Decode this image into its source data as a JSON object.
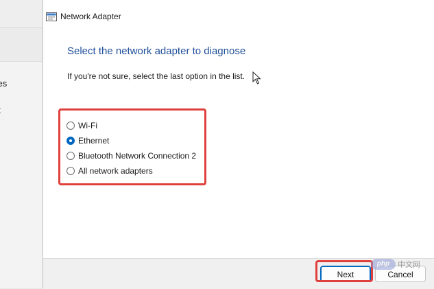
{
  "background_window": {
    "fragments": [
      "ces",
      "et"
    ]
  },
  "dialog": {
    "title": "Network Adapter",
    "heading": "Select the network adapter to diagnose",
    "subtext": "If you're not sure, select the last option in the list.",
    "options": [
      {
        "label": "Wi-Fi",
        "checked": false
      },
      {
        "label": "Ethernet",
        "checked": true
      },
      {
        "label": "Bluetooth Network Connection 2",
        "checked": false
      },
      {
        "label": "All network adapters",
        "checked": false
      }
    ],
    "buttons": {
      "next_label": "Next",
      "cancel_label": "Cancel"
    }
  },
  "watermark": {
    "logo_text": "php",
    "text": "中文网"
  },
  "colors": {
    "heading": "#1f4e99",
    "accent": "#0067c0",
    "highlight": "#e0403d"
  }
}
